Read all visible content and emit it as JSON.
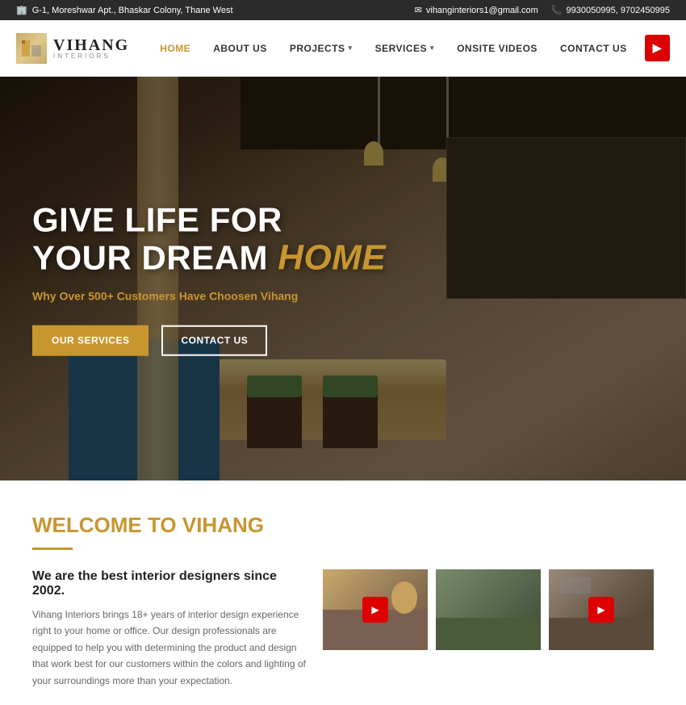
{
  "topbar": {
    "address": "G-1, Moreshwar Apt., Bhaskar Colony, Thane West",
    "email": "vihanginteriors1@gmail.com",
    "phones": "9930050995, 9702450995"
  },
  "navbar": {
    "brand": "VIHANG",
    "brand_sub": "INTERIORS",
    "nav_items": [
      {
        "label": "HOME",
        "active": true,
        "has_dropdown": false
      },
      {
        "label": "ABOUT US",
        "active": false,
        "has_dropdown": false
      },
      {
        "label": "PROJECTS",
        "active": false,
        "has_dropdown": true
      },
      {
        "label": "SERVICES",
        "active": false,
        "has_dropdown": true
      },
      {
        "label": "ONSITE VIDEOS",
        "active": false,
        "has_dropdown": false
      },
      {
        "label": "CONTACT US",
        "active": false,
        "has_dropdown": false
      }
    ]
  },
  "hero": {
    "title_line1": "GIVE LIFE FOR",
    "title_line2": "YOUR DREAM",
    "title_highlight": "HOME",
    "subtitle_prefix": "Why Over ",
    "subtitle_count": "500+",
    "subtitle_suffix": " Customers Have Choosen Vihang",
    "btn_services": "OUR SERVICES",
    "btn_contact": "CONTACT US"
  },
  "welcome": {
    "title_prefix": "WELCOME TO ",
    "title_brand": "VIHANG",
    "tagline": "We are the best interior designers since 2002.",
    "description": "Vihang Interiors brings 18+ years of interior design experience right to your home or office. Our design professionals are equipped to help you with determining the product and design that work best for our customers within the colors and lighting of your surroundings more than your expectation."
  }
}
